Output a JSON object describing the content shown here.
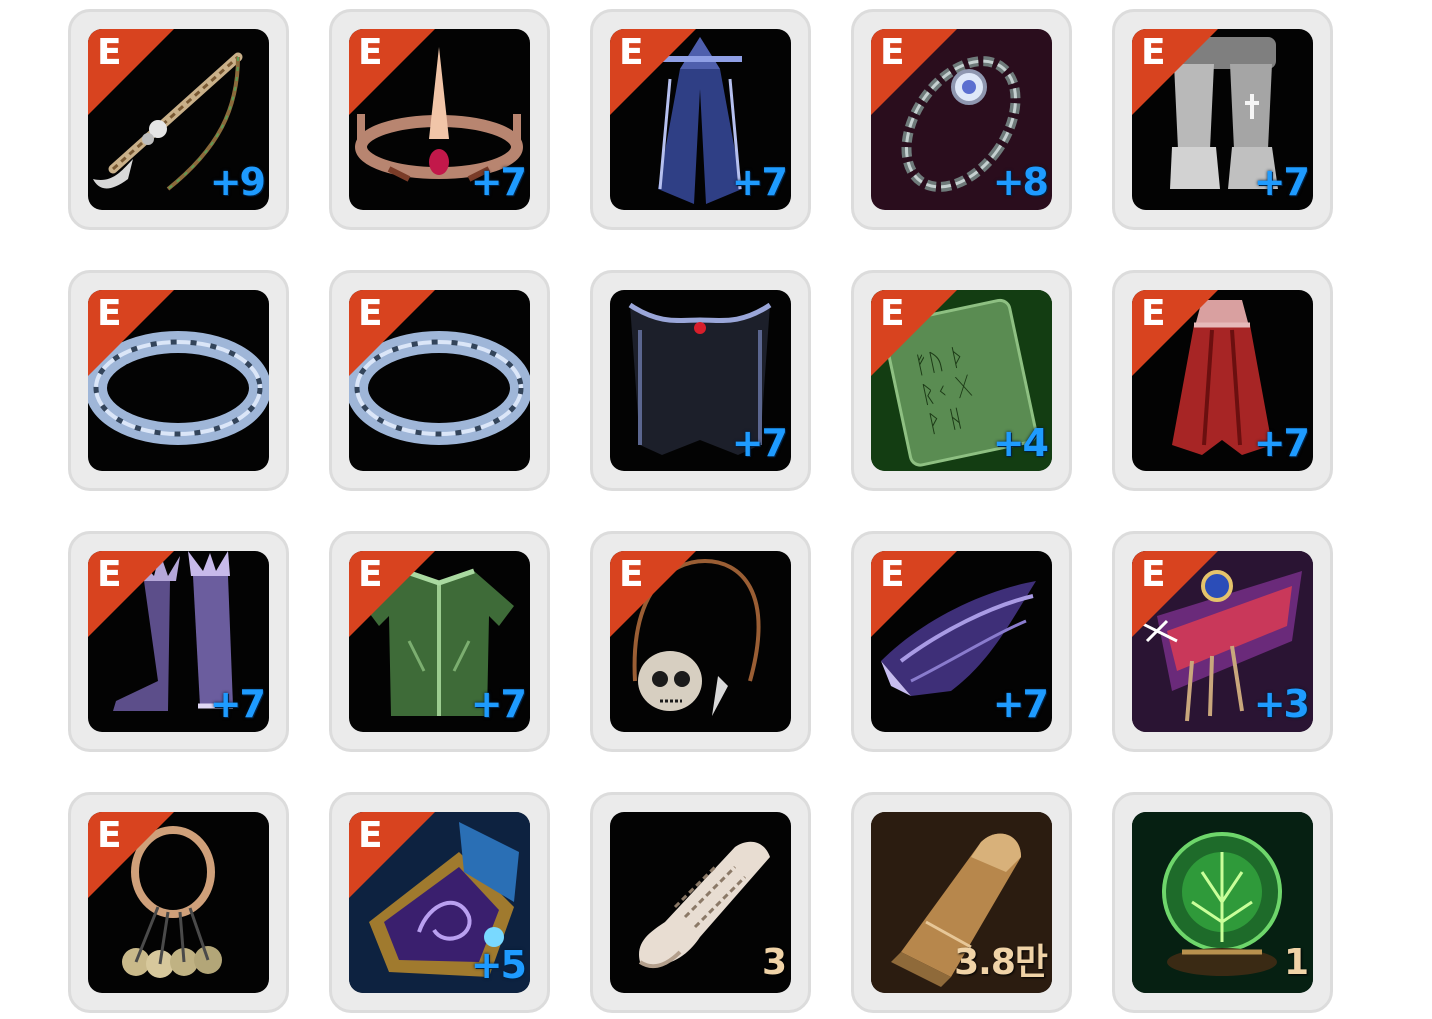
{
  "inventory": {
    "slots": [
      {
        "item": "crossbow-icon",
        "badge": "E",
        "enhancement": "+9",
        "quantity": "",
        "bg": "#030303"
      },
      {
        "item": "crown-icon",
        "badge": "E",
        "enhancement": "+7",
        "quantity": "",
        "bg": "#030303"
      },
      {
        "item": "blue-cloak-icon",
        "badge": "E",
        "enhancement": "+7",
        "quantity": "",
        "bg": "#030303"
      },
      {
        "item": "bracelet-icon",
        "badge": "E",
        "enhancement": "+8",
        "quantity": "",
        "bg": "#2a0d1d"
      },
      {
        "item": "armored-greaves-icon",
        "badge": "E",
        "enhancement": "+7",
        "quantity": "",
        "bg": "#030303"
      },
      {
        "item": "silver-ring-icon",
        "badge": "E",
        "enhancement": "",
        "quantity": "",
        "bg": "#030303"
      },
      {
        "item": "silver-ring-icon",
        "badge": "E",
        "enhancement": "",
        "quantity": "",
        "bg": "#030303"
      },
      {
        "item": "dark-cape-icon",
        "badge": "",
        "enhancement": "+7",
        "quantity": "",
        "bg": "#030303"
      },
      {
        "item": "rune-tablet-icon",
        "badge": "E",
        "enhancement": "+4",
        "quantity": "",
        "bg": "#0f2a0a"
      },
      {
        "item": "red-cloak-icon",
        "badge": "E",
        "enhancement": "+7",
        "quantity": "",
        "bg": "#030303"
      },
      {
        "item": "spiked-boots-icon",
        "badge": "E",
        "enhancement": "+7",
        "quantity": "",
        "bg": "#030303"
      },
      {
        "item": "green-tunic-icon",
        "badge": "E",
        "enhancement": "+7",
        "quantity": "",
        "bg": "#030303"
      },
      {
        "item": "skull-necklace-icon",
        "badge": "E",
        "enhancement": "",
        "quantity": "",
        "bg": "#030303"
      },
      {
        "item": "winged-shoulder-icon",
        "badge": "E",
        "enhancement": "+7",
        "quantity": "",
        "bg": "#030303"
      },
      {
        "item": "ornate-belt-icon",
        "badge": "E",
        "enhancement": "+3",
        "quantity": "",
        "bg": "#1a0d22"
      },
      {
        "item": "skull-ring-icon",
        "badge": "E",
        "enhancement": "",
        "quantity": "",
        "bg": "#030303"
      },
      {
        "item": "arcane-gauntlet-icon",
        "badge": "E",
        "enhancement": "+5",
        "quantity": "",
        "bg": "#071526"
      },
      {
        "item": "scroll-icon",
        "badge": "",
        "enhancement": "",
        "quantity": "3",
        "bg": "#030303"
      },
      {
        "item": "bullet-icon",
        "badge": "",
        "enhancement": "",
        "quantity": "3.8만",
        "bg": "#1c120b"
      },
      {
        "item": "crystal-orb-icon",
        "badge": "",
        "enhancement": "",
        "quantity": "1",
        "bg": "#061a10"
      }
    ]
  }
}
